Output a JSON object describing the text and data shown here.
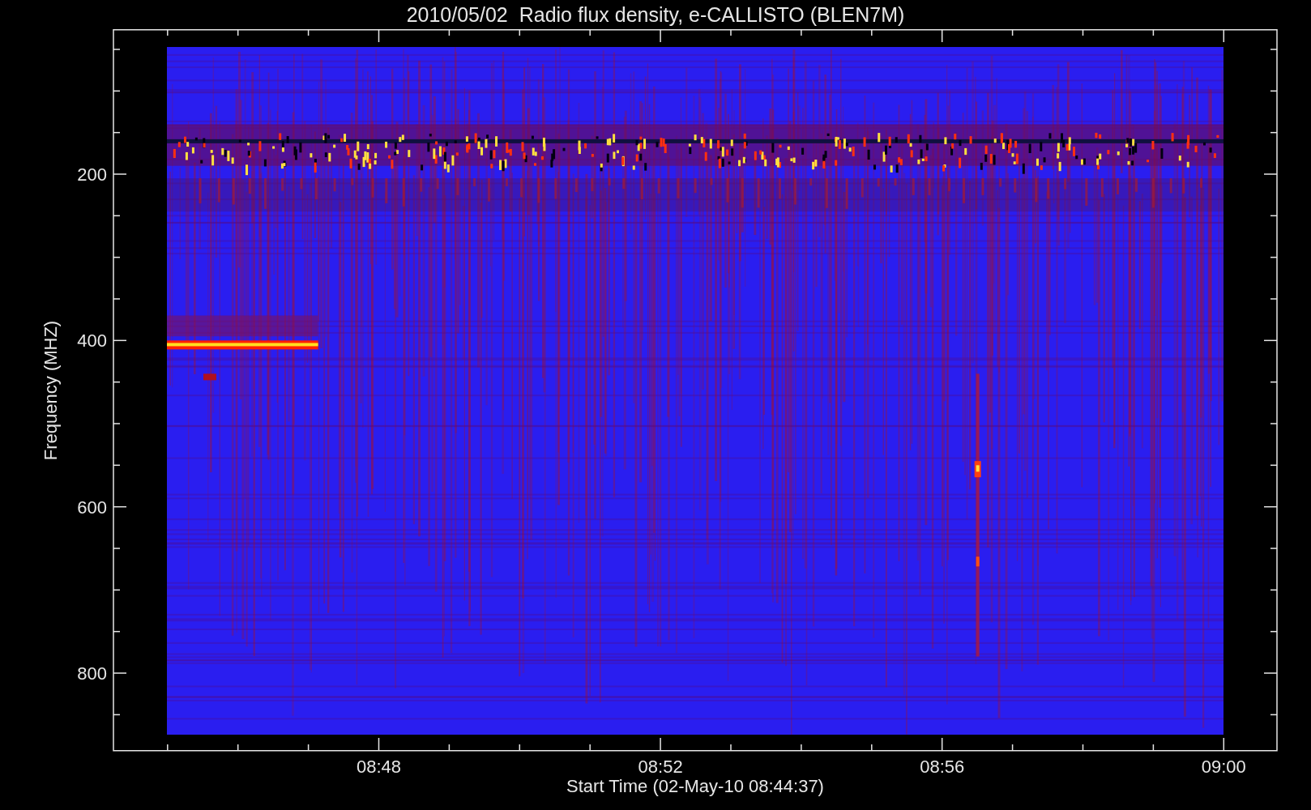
{
  "title": "2010/05/02  Radio flux density, e-CALLISTO (BLEN7M)",
  "y_axis": {
    "label": "Frequency (MHZ)",
    "ticks": [
      "200",
      "400",
      "600",
      "800"
    ]
  },
  "x_axis": {
    "label": "Start Time (02-May-10 08:44:37)",
    "ticks": [
      "08:48",
      "08:52",
      "08:56",
      "09:00"
    ]
  }
}
